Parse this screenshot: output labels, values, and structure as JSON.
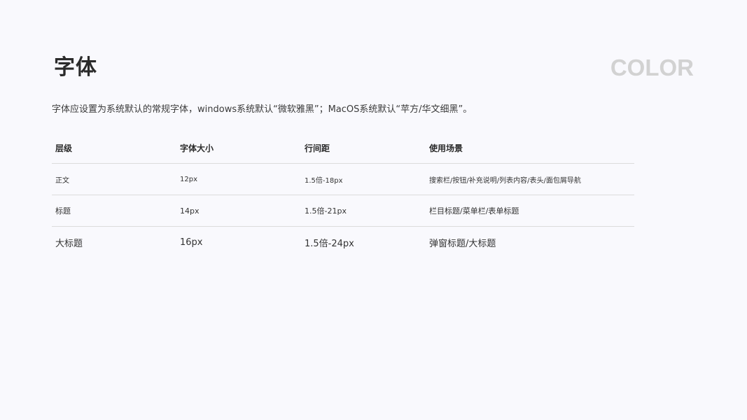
{
  "header": {
    "title": "字体",
    "section_label": "COLOR"
  },
  "intro": {
    "text": "字体应设置为系统默认的常规字体，windows系统默认“微软雅黑”；MacOS系统默认“苹方/华文细黑”。"
  },
  "table": {
    "headers": {
      "level": "层级",
      "size": "字体大小",
      "line_height": "行间距",
      "usage": "使用场景"
    },
    "rows": [
      {
        "level": "正文",
        "size": "12px",
        "line_height": "1.5倍-18px",
        "usage": "搜索栏/按钮/补充说明/列表内容/表头/面包屑导航"
      },
      {
        "level": "标题",
        "size": "14px",
        "line_height": "1.5倍-21px",
        "usage": "栏目标题/菜单栏/表单标题"
      },
      {
        "level": "大标题",
        "size": "16px",
        "line_height": "1.5倍-24px",
        "usage": "弹窗标题/大标题"
      }
    ]
  },
  "colors": {
    "background": "#f9f9fd",
    "text": "#333333",
    "section_label": "#d2d2d2",
    "divider": "#dcdcdc"
  }
}
